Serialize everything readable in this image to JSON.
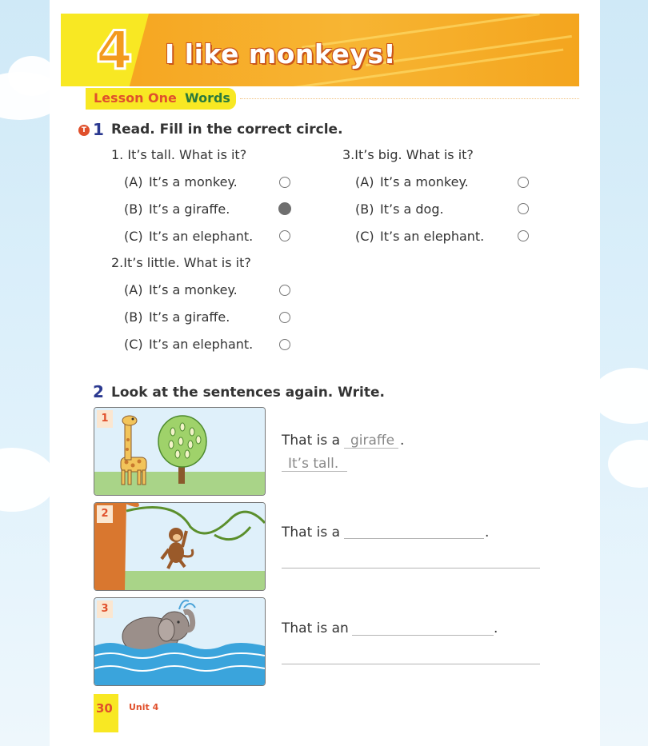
{
  "header": {
    "unit_number": "4",
    "title": "I like monkeys!",
    "lesson": "Lesson One",
    "lesson_topic": "Words",
    "badge": "T"
  },
  "exercise1": {
    "number": "1",
    "instruction": "Read. Fill in the correct circle.",
    "questions": [
      {
        "prompt": "1. It’s tall. What is it?",
        "options": [
          {
            "letter": "(A)",
            "text": "It’s a monkey.",
            "selected": false
          },
          {
            "letter": "(B)",
            "text": "It’s a giraffe.",
            "selected": true
          },
          {
            "letter": "(C)",
            "text": "It’s an elephant.",
            "selected": false
          }
        ]
      },
      {
        "prompt": "2.It’s little. What is it?",
        "options": [
          {
            "letter": "(A)",
            "text": "It’s a monkey.",
            "selected": false
          },
          {
            "letter": "(B)",
            "text": "It’s a giraffe.",
            "selected": false
          },
          {
            "letter": "(C)",
            "text": "It’s an elephant.",
            "selected": false
          }
        ]
      },
      {
        "prompt": "3.It’s big. What is it?",
        "options": [
          {
            "letter": "(A)",
            "text": "It’s a monkey.",
            "selected": false
          },
          {
            "letter": "(B)",
            "text": "It’s a dog.",
            "selected": false
          },
          {
            "letter": "(C)",
            "text": "It’s an elephant.",
            "selected": false
          }
        ]
      }
    ]
  },
  "exercise2": {
    "number": "2",
    "instruction": "Look at the sentences again. Write.",
    "items": [
      {
        "pic_label": "1",
        "prefix": "That is a",
        "answer": "giraffe",
        "end": ".",
        "second_answer": "It’s tall."
      },
      {
        "pic_label": "2",
        "prefix": "That is a",
        "answer": "",
        "end": ".",
        "second_answer": ""
      },
      {
        "pic_label": "3",
        "prefix": "That is an",
        "answer": "",
        "end": ".",
        "second_answer": ""
      }
    ]
  },
  "footer": {
    "page_number": "30",
    "unit_label": "Unit 4"
  },
  "colors": {
    "banner_orange": "#f6a21c",
    "yellow": "#f8e823",
    "accent_red": "#e0502c",
    "navy": "#2b3990"
  }
}
